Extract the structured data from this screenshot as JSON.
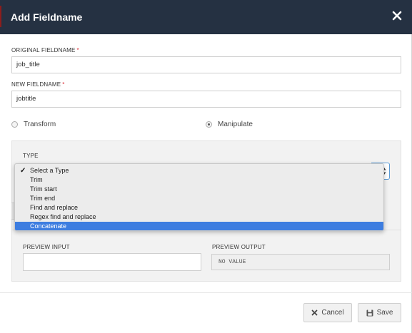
{
  "modal": {
    "title": "Add Fieldname"
  },
  "form": {
    "original": {
      "label": "ORIGINAL FIELDNAME",
      "required_mark": "*",
      "value": "job_title"
    },
    "new": {
      "label": "NEW FIELDNAME",
      "required_mark": "*",
      "value": "jobtitle"
    },
    "mode": {
      "options": [
        "Transform",
        "Manipulate"
      ],
      "selected": "Manipulate"
    },
    "type": {
      "label": "TYPE",
      "options": [
        "Select a Type",
        "Trim",
        "Trim start",
        "Trim end",
        "Find and replace",
        "Regex find and replace",
        "Concatenate"
      ],
      "checked": "Select a Type",
      "highlighted": "Concatenate"
    },
    "preview": {
      "input_label": "PREVIEW INPUT",
      "input_value": "",
      "output_label": "PREVIEW OUTPUT",
      "output_value": "NO VALUE"
    }
  },
  "footer": {
    "cancel_label": "Cancel",
    "save_label": "Save"
  },
  "colors": {
    "header_bg": "#253142",
    "highlight": "#3d7de0",
    "required": "#d9232d",
    "select_focus": "#5b9bd5"
  }
}
